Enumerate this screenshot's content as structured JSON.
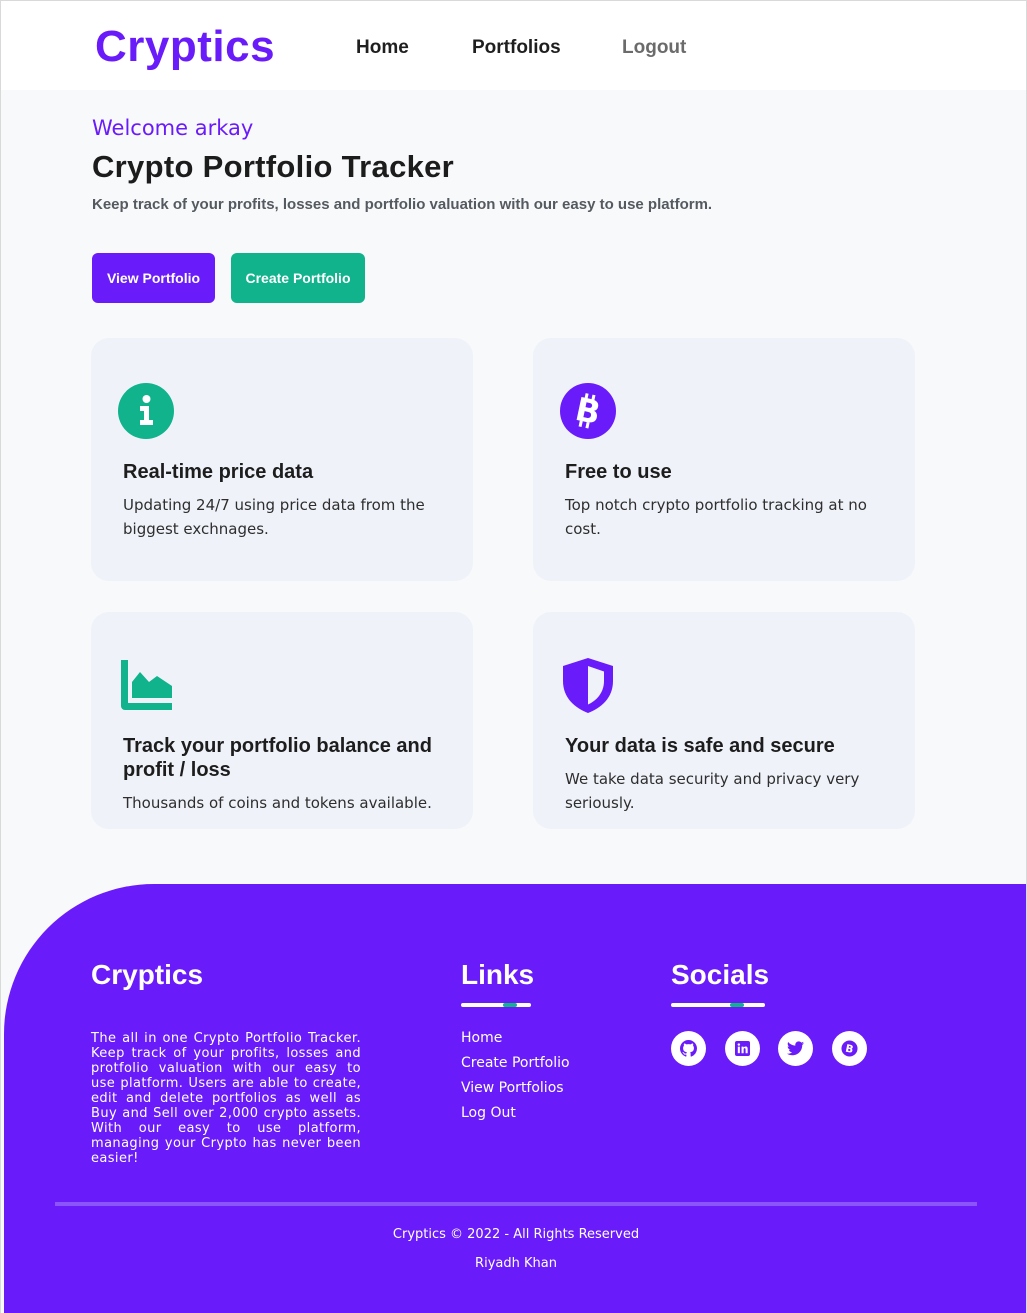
{
  "nav": {
    "brand": "Cryptics",
    "links": [
      "Home",
      "Portfolios",
      "Logout"
    ]
  },
  "hero": {
    "welcome": "Welcome arkay",
    "title": "Crypto Portfolio Tracker",
    "subtitle": "Keep track of your profits, losses and portfolio valuation with our easy to use platform.",
    "buttons": {
      "view": "View Portfolio",
      "create": "Create Portfolio"
    }
  },
  "features": [
    {
      "icon": "info-icon",
      "title": "Real-time price data",
      "text": "Updating 24/7 using price data from the biggest exchnages."
    },
    {
      "icon": "bitcoin-icon",
      "title": "Free to use",
      "text": "Top notch crypto portfolio tracking at no cost."
    },
    {
      "icon": "area-chart-icon",
      "title": "Track your portfolio balance and profit / loss",
      "text": "Thousands of coins and tokens available."
    },
    {
      "icon": "shield-icon",
      "title": "Your data is safe and secure",
      "text": "We take data security and privacy very seriously."
    }
  ],
  "footer": {
    "brand": "Cryptics",
    "about": "The all in one Crypto Portfolio Tracker. Keep track of your profits, losses and protfolio valuation with our easy to use platform. Users are able to create, edit and delete portfolios as well as Buy and Sell over 2,000 crypto assets. With our easy to use platform, managing your Crypto has never been easier!",
    "links_heading": "Links",
    "links": [
      "Home",
      "Create Portfolio",
      "View Portfolios",
      "Log Out"
    ],
    "socials_heading": "Socials",
    "socials": [
      "github-icon",
      "linkedin-icon",
      "twitter-icon",
      "bitcoin-icon"
    ],
    "copyright": "Cryptics © 2022 - All Rights Reserved",
    "author": "Riyadh Khan"
  },
  "colors": {
    "brand": "#6a1bfa",
    "accent": "#10b38b",
    "card_bg": "#eff2f9",
    "page_bg": "#f8f9fb"
  }
}
